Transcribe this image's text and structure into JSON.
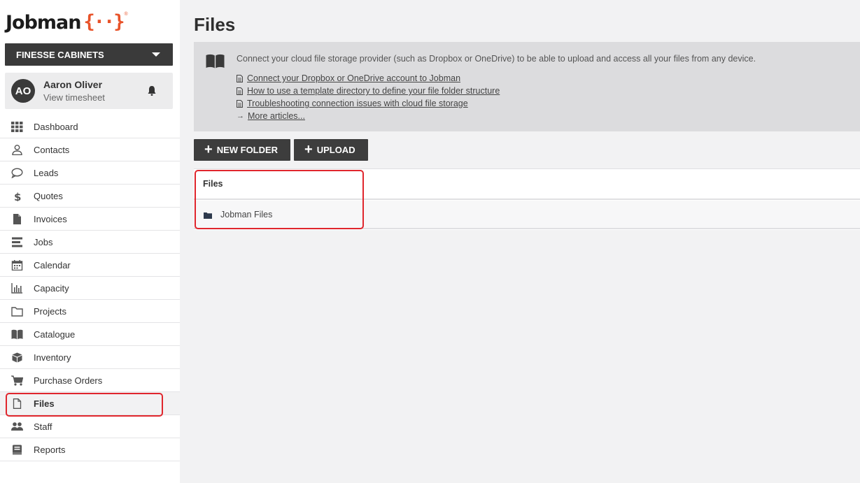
{
  "app": {
    "logo_text": "Jobman",
    "logo_mark": "{··}",
    "logo_reg": "®",
    "accent_color": "#e8532a"
  },
  "sidebar": {
    "company": "FINESSE CABINETS",
    "user": {
      "initials": "AO",
      "name": "Aaron Oliver",
      "sub_link": "View timesheet"
    },
    "items": [
      {
        "label": "Dashboard",
        "icon": "grid-icon"
      },
      {
        "label": "Contacts",
        "icon": "person-icon"
      },
      {
        "label": "Leads",
        "icon": "chat-bubble-icon"
      },
      {
        "label": "Quotes",
        "icon": "dollar-icon"
      },
      {
        "label": "Invoices",
        "icon": "document-icon"
      },
      {
        "label": "Jobs",
        "icon": "list-bars-icon"
      },
      {
        "label": "Calendar",
        "icon": "calendar-icon"
      },
      {
        "label": "Capacity",
        "icon": "bar-chart-icon"
      },
      {
        "label": "Projects",
        "icon": "folder-icon"
      },
      {
        "label": "Catalogue",
        "icon": "book-icon"
      },
      {
        "label": "Inventory",
        "icon": "box-icon"
      },
      {
        "label": "Purchase Orders",
        "icon": "cart-icon"
      },
      {
        "label": "Files",
        "icon": "file-outline-icon",
        "active": true
      },
      {
        "label": "Staff",
        "icon": "people-icon"
      },
      {
        "label": "Reports",
        "icon": "report-icon"
      }
    ]
  },
  "main": {
    "title": "Files",
    "info": {
      "text": "Connect your cloud file storage provider (such as Dropbox or OneDrive) to be able to upload and access all your files from any device.",
      "links": [
        "Connect your Dropbox or OneDrive account to Jobman",
        "How to use a template directory to define your file folder structure",
        "Troubleshooting connection issues with cloud file storage"
      ],
      "more": "More articles..."
    },
    "buttons": {
      "new_folder": "NEW FOLDER",
      "upload": "UPLOAD"
    },
    "files_table": {
      "header": "Files",
      "rows": [
        "Jobman Files"
      ]
    }
  }
}
